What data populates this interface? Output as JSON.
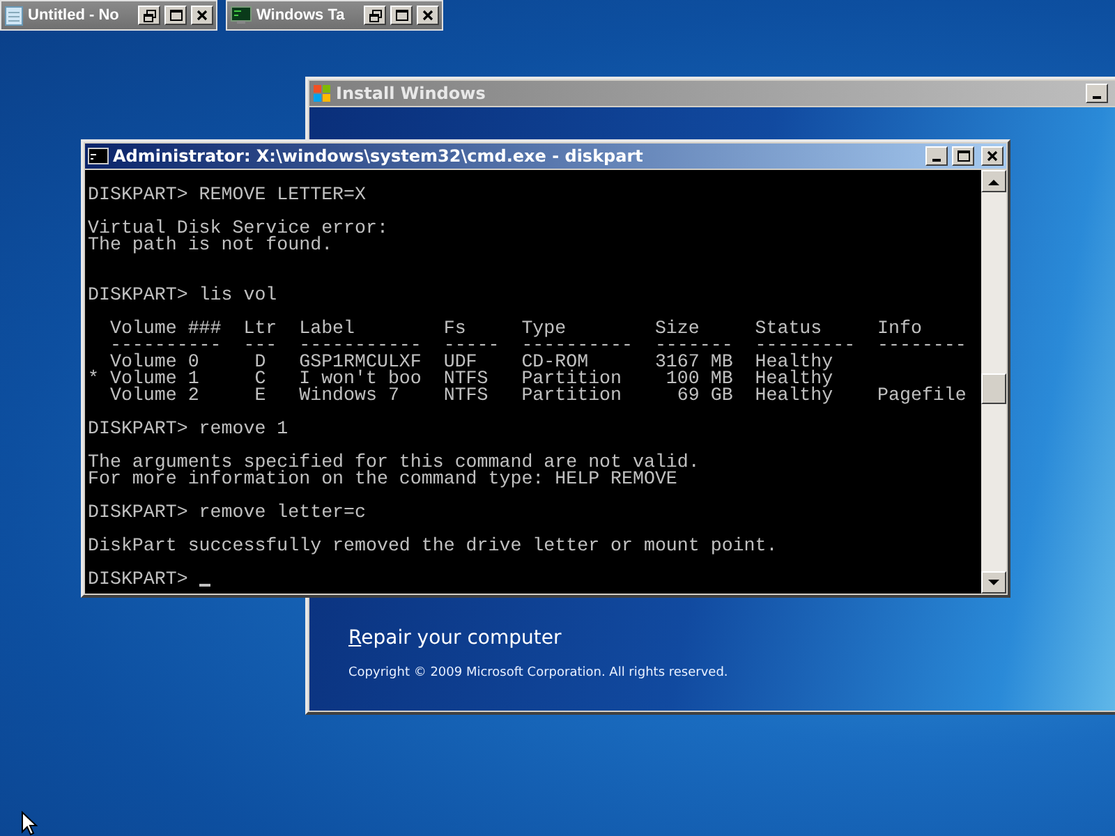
{
  "minimized_windows": [
    {
      "title": "Untitled - No",
      "kind": "notepad"
    },
    {
      "title": "Windows Ta",
      "kind": "console"
    }
  ],
  "setup_window": {
    "title": "Install Windows",
    "repair_link": "Repair your computer",
    "copyright": "Copyright © 2009 Microsoft Corporation. All rights reserved."
  },
  "console_window": {
    "title": "Administrator: X:\\windows\\system32\\cmd.exe - diskpart",
    "blocks": [
      {
        "kind": "single",
        "lines": [
          "DISKPART> REMOVE LETTER=X"
        ]
      },
      {
        "kind": "single",
        "lines": [
          "Virtual Disk Service error:",
          "The path is not found."
        ]
      },
      {
        "kind": "double",
        "lines": [
          "DISKPART> lis vol"
        ]
      },
      {
        "kind": "single",
        "lines": [
          "  Volume ###  Ltr  Label        Fs     Type        Size     Status     Info",
          "  ----------  ---  -----------  -----  ----------  -------  ---------  --------",
          "  Volume 0     D   GSP1RMCULXF  UDF    CD-ROM      3167 MB  Healthy",
          "* Volume 1     C   I won't boo  NTFS   Partition    100 MB  Healthy",
          "  Volume 2     E   Windows 7    NTFS   Partition     69 GB  Healthy    Pagefile"
        ]
      },
      {
        "kind": "single",
        "lines": [
          "DISKPART> remove 1"
        ]
      },
      {
        "kind": "single",
        "lines": [
          "The arguments specified for this command are not valid.",
          "For more information on the command type: HELP REMOVE"
        ]
      },
      {
        "kind": "single",
        "lines": [
          "DISKPART> remove letter=c"
        ]
      },
      {
        "kind": "single",
        "lines": [
          "DiskPart successfully removed the drive letter or mount point."
        ]
      },
      {
        "kind": "single",
        "lines": [
          "DISKPART> "
        ]
      }
    ],
    "cursor_visible": true
  }
}
